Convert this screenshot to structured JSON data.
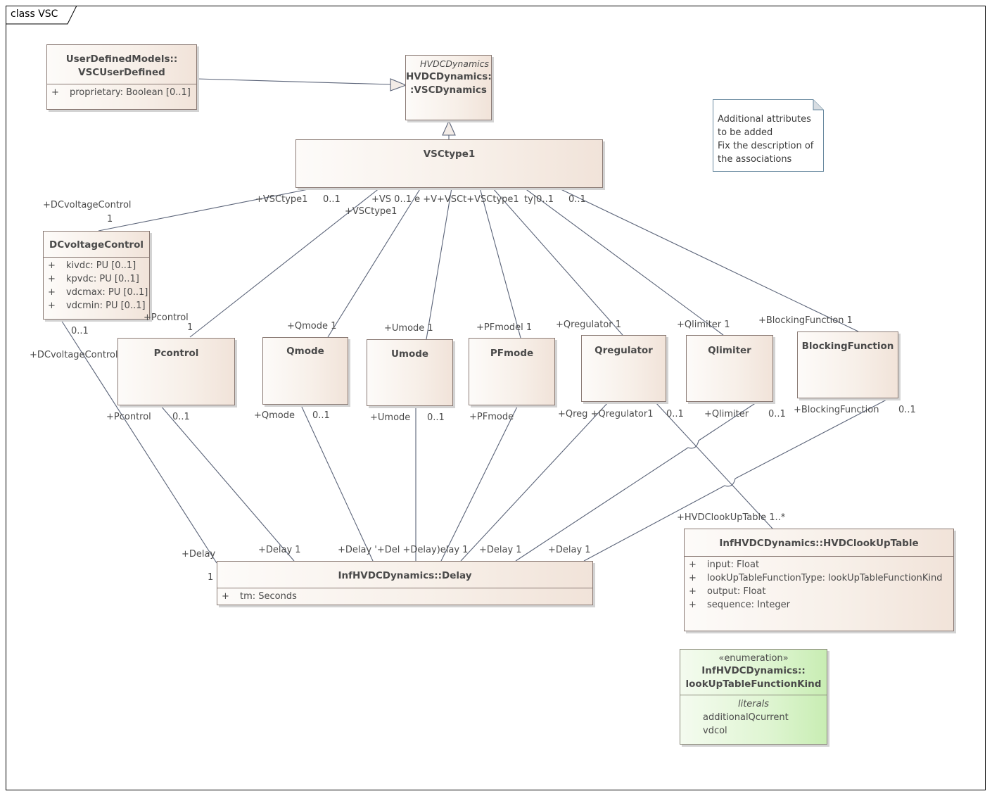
{
  "diagram": {
    "frame_title": "class VSC",
    "note": {
      "lines": [
        "Additional attributes",
        "to be added",
        "Fix the description of",
        "the associations"
      ]
    },
    "classes": {
      "vsc_user_defined": {
        "name_line1": "UserDefinedModels::",
        "name_line2": "VSCUserDefined",
        "attributes": [
          {
            "vis": "+",
            "text": "proprietary: Boolean [0..1]"
          }
        ]
      },
      "vsc_dynamics": {
        "stereotype": "HVDCDynamics",
        "name_line1": "HVDCDynamics:",
        "name_line2": ":VSCDynamics"
      },
      "vsc_type1": {
        "name": "VSCtype1"
      },
      "dc_voltage_control": {
        "name": "DCvoltageControl",
        "attributes": [
          {
            "vis": "+",
            "text": "kivdc: PU [0..1]"
          },
          {
            "vis": "+",
            "text": "kpvdc: PU [0..1]"
          },
          {
            "vis": "+",
            "text": "vdcmax: PU [0..1]"
          },
          {
            "vis": "+",
            "text": "vdcmin: PU [0..1]"
          }
        ]
      },
      "pcontrol": {
        "name": "Pcontrol"
      },
      "qmode": {
        "name": "Qmode"
      },
      "umode": {
        "name": "Umode"
      },
      "pfmode": {
        "name": "PFmode"
      },
      "qregulator": {
        "name": "Qregulator"
      },
      "qlimiter": {
        "name": "Qlimiter"
      },
      "blocking_function": {
        "name": "BlockingFunction"
      },
      "delay": {
        "name": "InfHVDCDynamics::Delay",
        "attributes": [
          {
            "vis": "+",
            "text": "tm: Seconds"
          }
        ]
      },
      "lookup_table": {
        "name": "InfHVDCDynamics::HVDClookUpTable",
        "attributes": [
          {
            "vis": "+",
            "text": "input: Float"
          },
          {
            "vis": "+",
            "text": "lookUpTableFunctionType: lookUpTableFunctionKind"
          },
          {
            "vis": "+",
            "text": "output: Float"
          },
          {
            "vis": "+",
            "text": "sequence: Integer"
          }
        ]
      },
      "lookup_kind": {
        "stereotype": "«enumeration»",
        "name_line1": "InfHVDCDynamics::",
        "name_line2": "lookUpTableFunctionKind",
        "section": "literals",
        "literals": [
          "additionalQcurrent",
          "vdcol"
        ]
      }
    },
    "labels": {
      "dcv_top_role": "+DCvoltageControl",
      "dcv_top_mult": "1",
      "vsc_dcv_role": "+VSCtype1",
      "vsc_dcv_mult": "0..1",
      "vsc_p_role": "+VSCtype1",
      "vsc_mid_text": "+VS 0..1 e +V+VSCt+VSCtype1",
      "vsc_right1": "ty|0..1",
      "vsc_right2": "0..1",
      "pcontrol_top_role": "+Pcontrol",
      "pcontrol_top_mult": "1",
      "qmode_top": "+Qmode 1",
      "umode_top": "+Umode 1",
      "pfmode_top": "+PFmodel 1",
      "qregulator_top": "+Qregulator  1",
      "qlimiter_top": "+Qlimiter  1",
      "blocking_top": "+BlockingFunction 1",
      "dcv_bottom_mult": "0..1",
      "dcv_bottom_role": "+DCvoltageControl",
      "pcontrol_bottom_role": "+Pcontrol",
      "pcontrol_bottom_mult": "0..1",
      "qmode_bottom_role": "+Qmode",
      "qmode_bottom_mult": "0..1",
      "umode_bottom_role": "+Umode",
      "umode_bottom_mult": "0..1",
      "pfmode_bottom_role": "+PFmode",
      "qreg_bottom_role": "+Qreg +Qregulator1",
      "qreg_bottom_mult": "0..1",
      "qlim_bottom_role": "+Qlimiter",
      "qlim_bottom_mult": "0..1",
      "block_bottom_role": "+BlockingFunction",
      "block_bottom_mult": "0..1",
      "lookup_role": "+HVDClookUpTable 1..*",
      "delay_left_role": "+Delay",
      "delay_left_mult": "1",
      "delay_roles_1": "+Delay  1",
      "delay_roles_2": "+Delay  '+Del +Delay)elay  1",
      "delay_roles_3": "+Delay  1",
      "delay_roles_4": "+Delay  1"
    }
  }
}
